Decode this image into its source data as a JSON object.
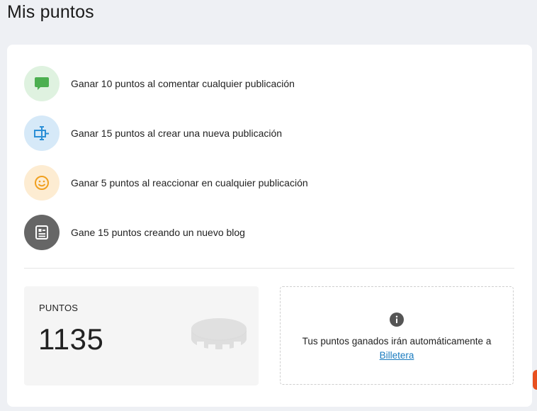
{
  "page": {
    "title": "Mis puntos"
  },
  "rules": [
    {
      "icon": "comment-icon",
      "color": "#4caf50",
      "label": "Ganar 10 puntos al comentar cualquier publicación"
    },
    {
      "icon": "new-post-icon",
      "color": "#2b8fd6",
      "label": "Ganar 15 puntos al crear una nueva publicación"
    },
    {
      "icon": "smiley-icon",
      "color": "#f0a020",
      "label": "Ganar 5 puntos al reaccionar en cualquier publicación"
    },
    {
      "icon": "blog-icon",
      "color": "#ffffff",
      "label": "Gane 15 puntos creando un nuevo blog"
    }
  ],
  "points": {
    "label": "PUNTOS",
    "value": "1135",
    "icon": "coin-icon"
  },
  "info": {
    "icon": "info-icon",
    "text": "Tus puntos ganados irán automáticamente a",
    "link_label": "Billetera",
    "link_color": "#1a7bbf"
  }
}
